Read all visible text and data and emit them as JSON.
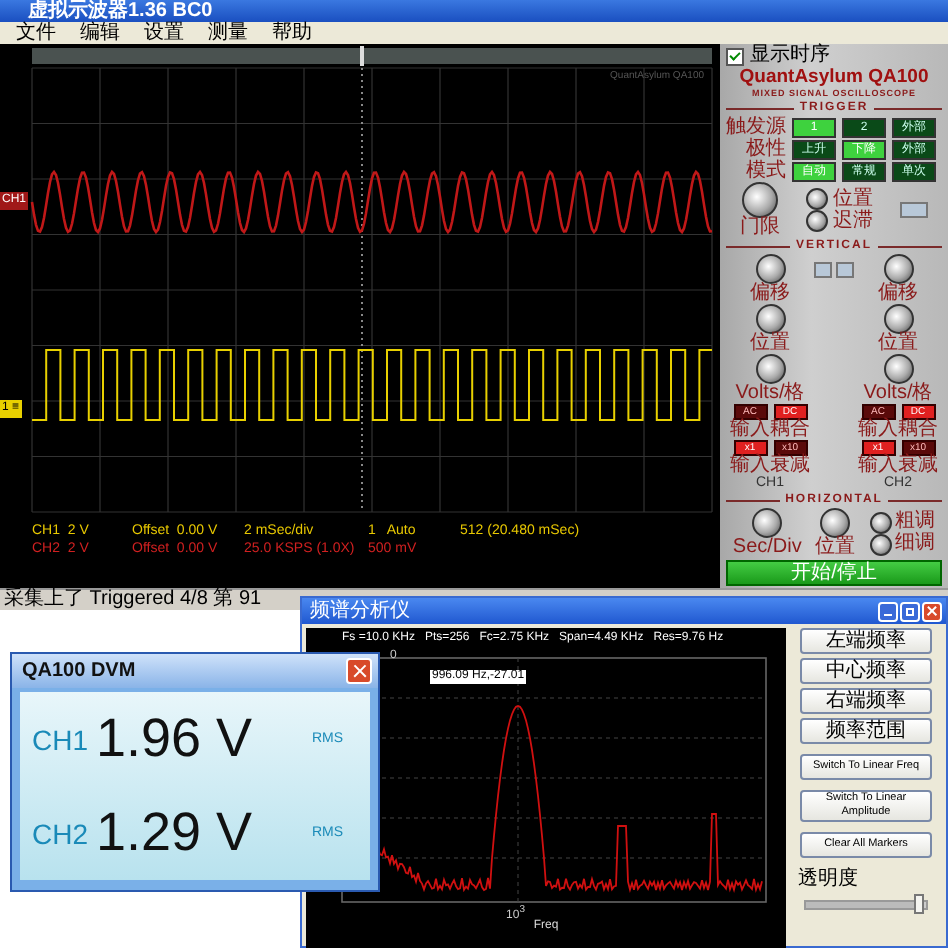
{
  "scope_window": {
    "title": "虚拟示波器1.36 BC0",
    "menu": [
      "文件",
      "编辑",
      "设置",
      "测量",
      "帮助"
    ],
    "screen": {
      "watermark": "QuantAsylum QA100",
      "ch1_marker": "CH1",
      "ch2_marker": "1 ≡",
      "readouts": [
        {
          "color": "#e8c800",
          "cells": [
            "CH1  2 V",
            "Offset  0.00 V",
            "2 mSec/div",
            "1   Auto",
            "512 (20.480 mSec)"
          ]
        },
        {
          "color": "#d02020",
          "cells": [
            "CH2  2 V",
            "Offset  0.00 V",
            "25.0 KSPS (1.0X)",
            "500 mV",
            ""
          ]
        }
      ]
    },
    "status_bar": "采集上了 Triggered 4/8 第 91"
  },
  "panel": {
    "show_option": {
      "label": "显示时序",
      "checked": true
    },
    "brand": "QuantAsylum QA100",
    "subtitle": "MIXED SIGNAL OSCILLOSCOPE",
    "trigger": {
      "title": "TRIGGER",
      "rows": [
        {
          "label": "触发源",
          "options": [
            {
              "label": "1",
              "selected": true
            },
            {
              "label": "2",
              "selected": false
            },
            {
              "label": "外部",
              "selected": false
            }
          ]
        },
        {
          "label": "极性",
          "options": [
            {
              "label": "上升",
              "selected": false
            },
            {
              "label": "下降",
              "selected": true
            },
            {
              "label": "外部",
              "selected": false
            }
          ]
        },
        {
          "label": "模式",
          "options": [
            {
              "label": "自动",
              "selected": true
            },
            {
              "label": "常规",
              "selected": false
            },
            {
              "label": "单次",
              "selected": false
            }
          ]
        }
      ],
      "level_knob": "门限",
      "small_knobs": [
        "位置",
        "迟滞"
      ]
    },
    "vertical": {
      "title": "VERTICAL",
      "channels": [
        {
          "name": "CH1",
          "knobs": [
            "偏移",
            "位置",
            "Volts/格"
          ],
          "coupling_label": "输入耦合",
          "coupling": [
            {
              "label": "AC",
              "selected": false
            },
            {
              "label": "DC",
              "selected": true
            }
          ],
          "attenuation_label": "输入衰减",
          "attenuation": [
            {
              "label": "x1",
              "selected": true
            },
            {
              "label": "x10",
              "selected": false
            }
          ]
        },
        {
          "name": "CH2",
          "knobs": [
            "偏移",
            "位置",
            "Volts/格"
          ],
          "coupling_label": "输入耦合",
          "coupling": [
            {
              "label": "AC",
              "selected": false
            },
            {
              "label": "DC",
              "selected": true
            }
          ],
          "attenuation_label": "输入衰减",
          "attenuation": [
            {
              "label": "x1",
              "selected": true
            },
            {
              "label": "x10",
              "selected": false
            }
          ]
        }
      ]
    },
    "horizontal": {
      "title": "HORIZONTAL",
      "knobs": [
        "Sec/Div",
        "位置"
      ],
      "small_knobs": [
        "粗调",
        "细调"
      ],
      "run_button": "开始/停止"
    }
  },
  "dvm_window": {
    "title": "QA100 DVM",
    "rows": [
      {
        "channel": "CH1",
        "value": "1.96 V",
        "mode": "RMS"
      },
      {
        "channel": "CH2",
        "value": "1.29 V",
        "mode": "RMS"
      }
    ]
  },
  "spectrum_window": {
    "title": "频谱分析仪",
    "header": "Fs =10.0 KHz   Pts=256   Fc=2.75 KHz   Span=4.49 KHz   Res=9.76 Hz",
    "y_tick": "0",
    "x_tick": "10$^{3}$",
    "marker": "996.09 Hz,-27.01",
    "xlabel": "Freq",
    "buttons": [
      "左端频率",
      "中心频率",
      "右端频率",
      "频率范围"
    ],
    "switch_buttons": [
      "Switch To Linear Freq",
      "Switch To Linear Amplitude"
    ],
    "clear_button": "Clear All Markers",
    "opacity": {
      "label": "透明度",
      "level": 0.95
    }
  }
}
